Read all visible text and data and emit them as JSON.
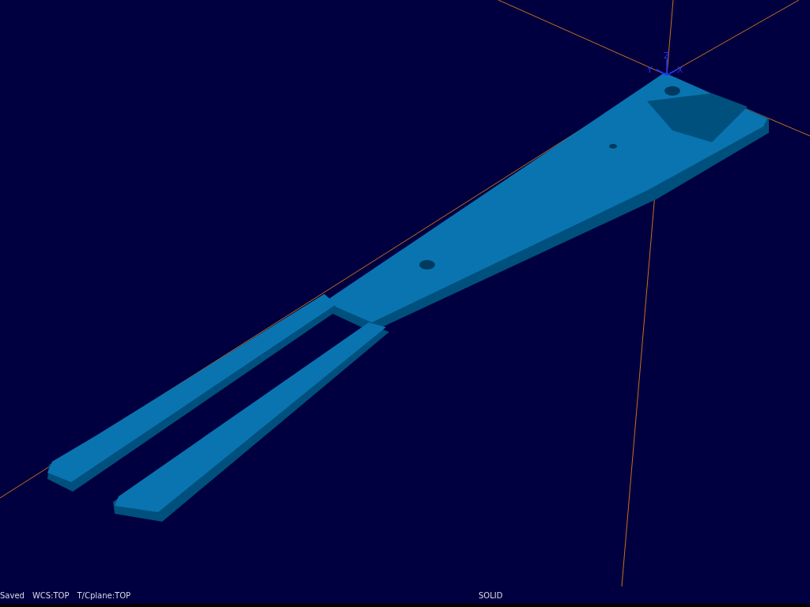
{
  "viewport": {
    "triad": {
      "x_label": "X",
      "y_label": "Y",
      "z_label": "Z"
    }
  },
  "status_bar": {
    "items": [
      "Saved",
      "WCS:TOP",
      "T/Cplane:TOP"
    ],
    "mode": "SOLID"
  }
}
